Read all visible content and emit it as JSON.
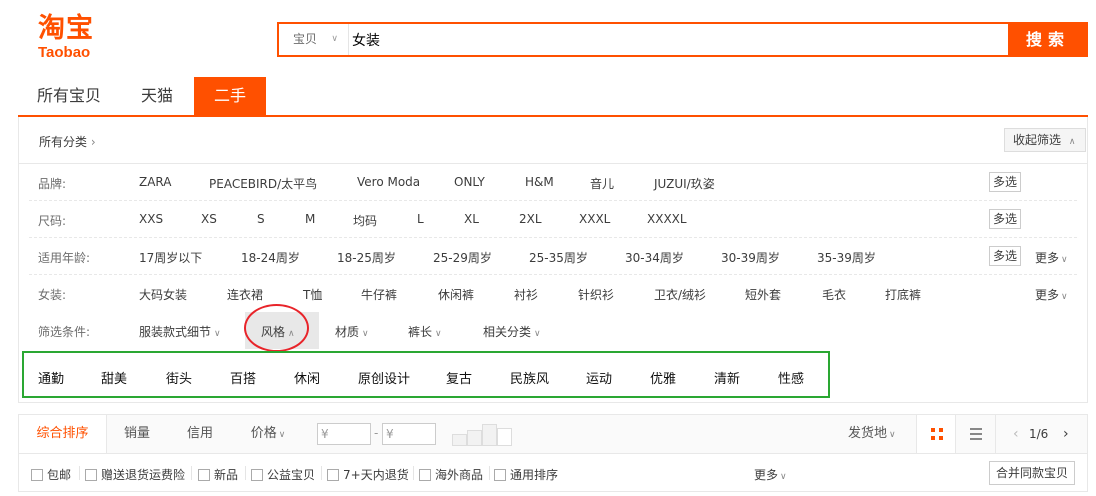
{
  "logo": {
    "cn": "淘宝",
    "en": "Taobao"
  },
  "search": {
    "category": "宝贝",
    "query": "女装",
    "button": "搜索"
  },
  "tabs": [
    "所有宝贝",
    "天猫",
    "二手"
  ],
  "breadcrumb": {
    "all": "所有分类",
    "collapse": "收起筛选"
  },
  "filters": {
    "brand": {
      "label": "品牌:",
      "values": [
        "ZARA",
        "PEACEBIRD/太平鸟",
        "Vero Moda",
        "ONLY",
        "H&M",
        "音儿",
        "JUZUI/玖姿"
      ],
      "multi": "多选"
    },
    "size": {
      "label": "尺码:",
      "values": [
        "XXS",
        "XS",
        "S",
        "M",
        "均码",
        "L",
        "XL",
        "2XL",
        "XXXL",
        "XXXXL"
      ],
      "multi": "多选"
    },
    "age": {
      "label": "适用年龄:",
      "values": [
        "17周岁以下",
        "18-24周岁",
        "18-25周岁",
        "25-29周岁",
        "25-35周岁",
        "30-34周岁",
        "30-39周岁",
        "35-39周岁"
      ],
      "multi": "多选",
      "more": "更多"
    },
    "womens": {
      "label": "女装:",
      "values": [
        "大码女装",
        "连衣裙",
        "T恤",
        "牛仔裤",
        "休闲裤",
        "衬衫",
        "针织衫",
        "卫衣/绒衫",
        "短外套",
        "毛衣",
        "打底裤"
      ],
      "more": "更多"
    },
    "conditions": {
      "label": "筛选条件:",
      "dropdowns": [
        "服装款式细节",
        "风格",
        "材质",
        "裤长",
        "相关分类"
      ]
    }
  },
  "styles": [
    "通勤",
    "甜美",
    "街头",
    "百搭",
    "休闲",
    "原创设计",
    "复古",
    "民族风",
    "运动",
    "优雅",
    "清新",
    "性感"
  ],
  "sortbar": {
    "sorts": [
      "综合排序",
      "销量",
      "信用",
      "价格"
    ],
    "price_from": "¥",
    "price_to": "¥",
    "dash": "-",
    "ship_from": "发货地",
    "page": "1/6"
  },
  "checkboxes": [
    "包邮",
    "赠送退货运费险",
    "新品",
    "公益宝贝",
    "7+天内退货",
    "海外商品",
    "通用排序"
  ],
  "more": "更多",
  "merge": "合并同款宝贝",
  "colors": {
    "accent": "#ff5000",
    "highlight_circle": "#e8242a",
    "highlight_box": "#2aa732"
  }
}
